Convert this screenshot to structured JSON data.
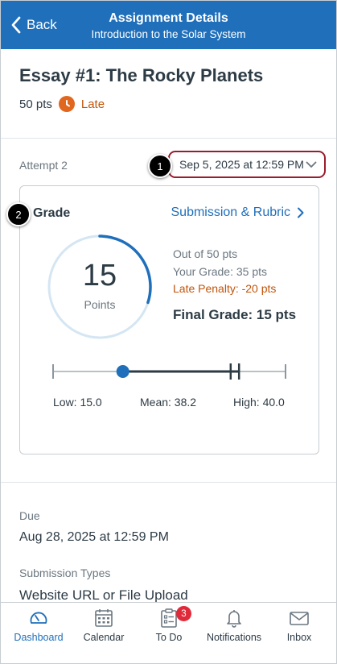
{
  "header": {
    "back_label": "Back",
    "title": "Assignment Details",
    "subtitle": "Introduction to the Solar System"
  },
  "assignment": {
    "title": "Essay #1: The Rocky Planets",
    "points": "50 pts",
    "status": "Late"
  },
  "attempt": {
    "label": "Attempt 2",
    "selected_date": "Sep 5, 2025 at 12:59 PM"
  },
  "callouts": [
    "1",
    "2"
  ],
  "grade": {
    "label": "Grade",
    "link_label": "Submission & Rubric",
    "score": "15",
    "score_unit": "Points",
    "score_fraction": 0.3,
    "out_of": "Out of 50 pts",
    "your_grade": "Your Grade: 35 pts",
    "late_penalty": "Late Penalty: -20 pts",
    "final_grade": "Final Grade: 15 pts",
    "stats": {
      "low_label": "Low: 15.0",
      "mean_label": "Mean: 38.2",
      "high_label": "High: 40.0",
      "low": 15.0,
      "mean": 38.2,
      "high": 40.0,
      "max": 50
    }
  },
  "details": {
    "due_label": "Due",
    "due_value": "Aug 28, 2025 at 12:59 PM",
    "submission_types_label": "Submission Types",
    "submission_types_value": "Website URL or File Upload"
  },
  "tabs": [
    {
      "label": "Dashboard",
      "icon": "dashboard-icon",
      "active": true
    },
    {
      "label": "Calendar",
      "icon": "calendar-icon",
      "active": false
    },
    {
      "label": "To Do",
      "icon": "todo-icon",
      "active": false,
      "badge": "3"
    },
    {
      "label": "Notifications",
      "icon": "bell-icon",
      "active": false
    },
    {
      "label": "Inbox",
      "icon": "inbox-icon",
      "active": false
    }
  ],
  "colors": {
    "brand": "#1f6fbb",
    "late": "#c2540a",
    "callout_border": "#9b1c2c",
    "badge": "#e02a3a"
  }
}
